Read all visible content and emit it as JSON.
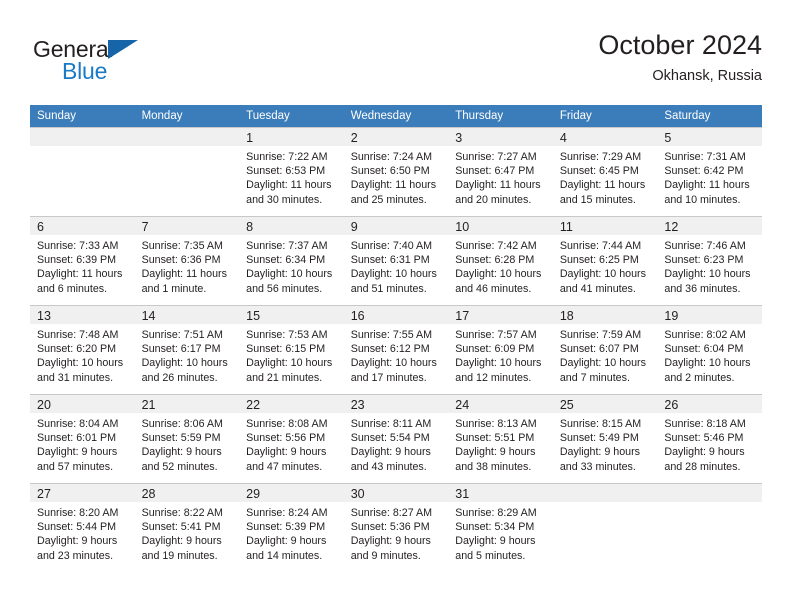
{
  "brand": {
    "name_top": "General",
    "name_bottom": "Blue",
    "triangle_color": "#1565a8",
    "blue_color": "#1a7bc4"
  },
  "header": {
    "title": "October 2024",
    "subtitle": "Okhansk, Russia",
    "header_bg": "#3b7cba",
    "band_bg": "#f0f0f0"
  },
  "weekday_headers": [
    "Sunday",
    "Monday",
    "Tuesday",
    "Wednesday",
    "Thursday",
    "Friday",
    "Saturday"
  ],
  "weeks": [
    [
      {
        "day": "",
        "lines": []
      },
      {
        "day": "",
        "lines": []
      },
      {
        "day": "1",
        "lines": [
          "Sunrise: 7:22 AM",
          "Sunset: 6:53 PM",
          "Daylight: 11 hours",
          "and 30 minutes."
        ]
      },
      {
        "day": "2",
        "lines": [
          "Sunrise: 7:24 AM",
          "Sunset: 6:50 PM",
          "Daylight: 11 hours",
          "and 25 minutes."
        ]
      },
      {
        "day": "3",
        "lines": [
          "Sunrise: 7:27 AM",
          "Sunset: 6:47 PM",
          "Daylight: 11 hours",
          "and 20 minutes."
        ]
      },
      {
        "day": "4",
        "lines": [
          "Sunrise: 7:29 AM",
          "Sunset: 6:45 PM",
          "Daylight: 11 hours",
          "and 15 minutes."
        ]
      },
      {
        "day": "5",
        "lines": [
          "Sunrise: 7:31 AM",
          "Sunset: 6:42 PM",
          "Daylight: 11 hours",
          "and 10 minutes."
        ]
      }
    ],
    [
      {
        "day": "6",
        "lines": [
          "Sunrise: 7:33 AM",
          "Sunset: 6:39 PM",
          "Daylight: 11 hours",
          "and 6 minutes."
        ]
      },
      {
        "day": "7",
        "lines": [
          "Sunrise: 7:35 AM",
          "Sunset: 6:36 PM",
          "Daylight: 11 hours",
          "and 1 minute."
        ]
      },
      {
        "day": "8",
        "lines": [
          "Sunrise: 7:37 AM",
          "Sunset: 6:34 PM",
          "Daylight: 10 hours",
          "and 56 minutes."
        ]
      },
      {
        "day": "9",
        "lines": [
          "Sunrise: 7:40 AM",
          "Sunset: 6:31 PM",
          "Daylight: 10 hours",
          "and 51 minutes."
        ]
      },
      {
        "day": "10",
        "lines": [
          "Sunrise: 7:42 AM",
          "Sunset: 6:28 PM",
          "Daylight: 10 hours",
          "and 46 minutes."
        ]
      },
      {
        "day": "11",
        "lines": [
          "Sunrise: 7:44 AM",
          "Sunset: 6:25 PM",
          "Daylight: 10 hours",
          "and 41 minutes."
        ]
      },
      {
        "day": "12",
        "lines": [
          "Sunrise: 7:46 AM",
          "Sunset: 6:23 PM",
          "Daylight: 10 hours",
          "and 36 minutes."
        ]
      }
    ],
    [
      {
        "day": "13",
        "lines": [
          "Sunrise: 7:48 AM",
          "Sunset: 6:20 PM",
          "Daylight: 10 hours",
          "and 31 minutes."
        ]
      },
      {
        "day": "14",
        "lines": [
          "Sunrise: 7:51 AM",
          "Sunset: 6:17 PM",
          "Daylight: 10 hours",
          "and 26 minutes."
        ]
      },
      {
        "day": "15",
        "lines": [
          "Sunrise: 7:53 AM",
          "Sunset: 6:15 PM",
          "Daylight: 10 hours",
          "and 21 minutes."
        ]
      },
      {
        "day": "16",
        "lines": [
          "Sunrise: 7:55 AM",
          "Sunset: 6:12 PM",
          "Daylight: 10 hours",
          "and 17 minutes."
        ]
      },
      {
        "day": "17",
        "lines": [
          "Sunrise: 7:57 AM",
          "Sunset: 6:09 PM",
          "Daylight: 10 hours",
          "and 12 minutes."
        ]
      },
      {
        "day": "18",
        "lines": [
          "Sunrise: 7:59 AM",
          "Sunset: 6:07 PM",
          "Daylight: 10 hours",
          "and 7 minutes."
        ]
      },
      {
        "day": "19",
        "lines": [
          "Sunrise: 8:02 AM",
          "Sunset: 6:04 PM",
          "Daylight: 10 hours",
          "and 2 minutes."
        ]
      }
    ],
    [
      {
        "day": "20",
        "lines": [
          "Sunrise: 8:04 AM",
          "Sunset: 6:01 PM",
          "Daylight: 9 hours",
          "and 57 minutes."
        ]
      },
      {
        "day": "21",
        "lines": [
          "Sunrise: 8:06 AM",
          "Sunset: 5:59 PM",
          "Daylight: 9 hours",
          "and 52 minutes."
        ]
      },
      {
        "day": "22",
        "lines": [
          "Sunrise: 8:08 AM",
          "Sunset: 5:56 PM",
          "Daylight: 9 hours",
          "and 47 minutes."
        ]
      },
      {
        "day": "23",
        "lines": [
          "Sunrise: 8:11 AM",
          "Sunset: 5:54 PM",
          "Daylight: 9 hours",
          "and 43 minutes."
        ]
      },
      {
        "day": "24",
        "lines": [
          "Sunrise: 8:13 AM",
          "Sunset: 5:51 PM",
          "Daylight: 9 hours",
          "and 38 minutes."
        ]
      },
      {
        "day": "25",
        "lines": [
          "Sunrise: 8:15 AM",
          "Sunset: 5:49 PM",
          "Daylight: 9 hours",
          "and 33 minutes."
        ]
      },
      {
        "day": "26",
        "lines": [
          "Sunrise: 8:18 AM",
          "Sunset: 5:46 PM",
          "Daylight: 9 hours",
          "and 28 minutes."
        ]
      }
    ],
    [
      {
        "day": "27",
        "lines": [
          "Sunrise: 8:20 AM",
          "Sunset: 5:44 PM",
          "Daylight: 9 hours",
          "and 23 minutes."
        ]
      },
      {
        "day": "28",
        "lines": [
          "Sunrise: 8:22 AM",
          "Sunset: 5:41 PM",
          "Daylight: 9 hours",
          "and 19 minutes."
        ]
      },
      {
        "day": "29",
        "lines": [
          "Sunrise: 8:24 AM",
          "Sunset: 5:39 PM",
          "Daylight: 9 hours",
          "and 14 minutes."
        ]
      },
      {
        "day": "30",
        "lines": [
          "Sunrise: 8:27 AM",
          "Sunset: 5:36 PM",
          "Daylight: 9 hours",
          "and 9 minutes."
        ]
      },
      {
        "day": "31",
        "lines": [
          "Sunrise: 8:29 AM",
          "Sunset: 5:34 PM",
          "Daylight: 9 hours",
          "and 5 minutes."
        ]
      },
      {
        "day": "",
        "lines": []
      },
      {
        "day": "",
        "lines": []
      }
    ]
  ]
}
